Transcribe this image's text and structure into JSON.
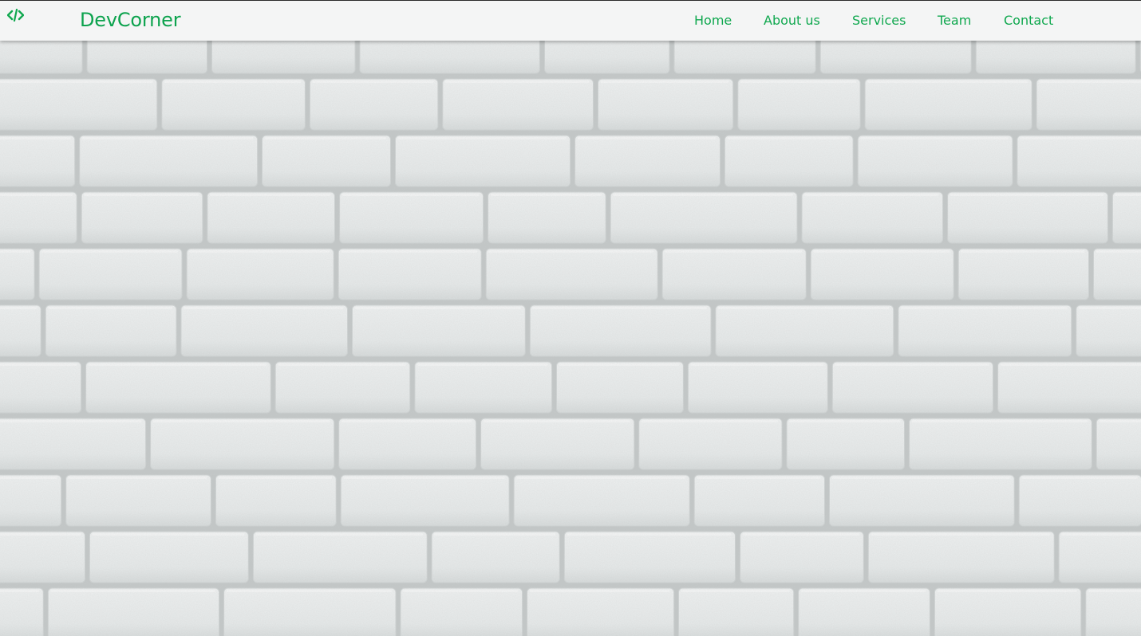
{
  "navbar": {
    "logo_icon": "code-icon",
    "brand": "DevCorner",
    "links": [
      "Home",
      "About us",
      "Services",
      "Team",
      "Contact"
    ]
  },
  "hero": {
    "background": "white-brick-wall"
  },
  "colors": {
    "accent": "#10a84f",
    "navbar_bg": "#f4f5f5",
    "brick": "#e6e9e9",
    "mortar": "#b9bdbd"
  }
}
